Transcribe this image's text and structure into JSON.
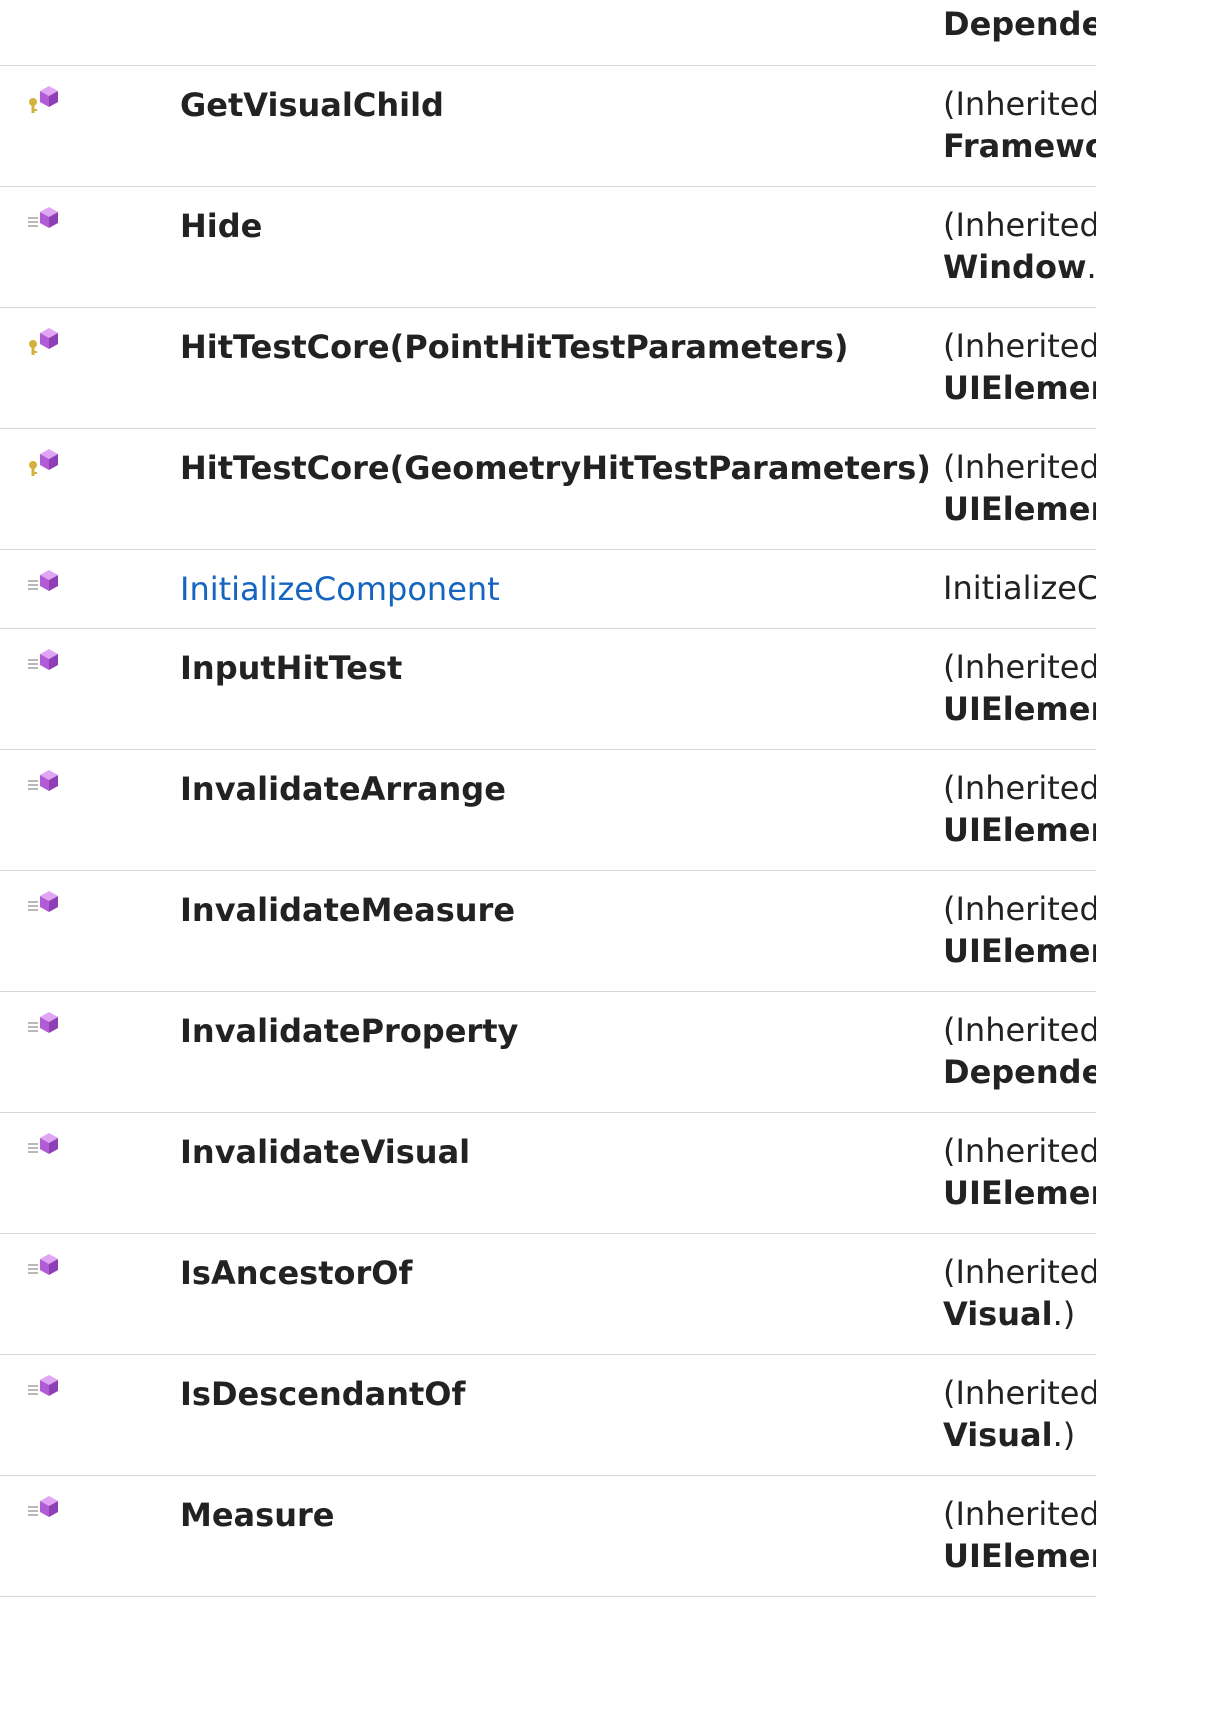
{
  "top_row": {
    "desc_line2_strong": "Dependency"
  },
  "rows": [
    {
      "icon": "protected-method-icon",
      "name": "GetVisualChild",
      "name_style": "bold",
      "desc_line1": "(Inherited from",
      "desc_line2_strong": "FrameworkElement",
      "desc_line2_tail": ""
    },
    {
      "icon": "public-method-icon",
      "name": "Hide",
      "name_style": "bold",
      "desc_line1": "(Inherited from",
      "desc_line2_strong": "Window",
      "desc_line2_tail": ".)"
    },
    {
      "icon": "protected-method-icon",
      "name": "HitTestCore(PointHitTestParameters)",
      "name_style": "bold",
      "desc_line1": "(Inherited from",
      "desc_line2_strong": "UIElement",
      "desc_line2_tail": ""
    },
    {
      "icon": "protected-method-icon",
      "name": "HitTestCore(GeometryHitTestParameters)",
      "name_style": "bold",
      "desc_line1": "(Inherited from",
      "desc_line2_strong": "UIElement",
      "desc_line2_tail": ""
    },
    {
      "icon": "public-method-icon",
      "name": "InitializeComponent",
      "name_style": "link",
      "desc_line1": "InitializeComponent",
      "desc_line2_strong": "",
      "desc_line2_tail": ""
    },
    {
      "icon": "public-method-icon",
      "name": "InputHitTest",
      "name_style": "bold",
      "desc_line1": "(Inherited from",
      "desc_line2_strong": "UIElement",
      "desc_line2_tail": ""
    },
    {
      "icon": "public-method-icon",
      "name": "InvalidateArrange",
      "name_style": "bold",
      "desc_line1": "(Inherited from",
      "desc_line2_strong": "UIElement",
      "desc_line2_tail": ""
    },
    {
      "icon": "public-method-icon",
      "name": "InvalidateMeasure",
      "name_style": "bold",
      "desc_line1": "(Inherited from",
      "desc_line2_strong": "UIElement",
      "desc_line2_tail": ""
    },
    {
      "icon": "public-method-icon",
      "name": "InvalidateProperty",
      "name_style": "bold",
      "desc_line1": "(Inherited from",
      "desc_line2_strong": "DependencyObject",
      "desc_line2_tail": ""
    },
    {
      "icon": "public-method-icon",
      "name": "InvalidateVisual",
      "name_style": "bold",
      "desc_line1": "(Inherited from",
      "desc_line2_strong": "UIElement",
      "desc_line2_tail": ""
    },
    {
      "icon": "public-method-icon",
      "name": "IsAncestorOf",
      "name_style": "bold",
      "desc_line1": "(Inherited from",
      "desc_line2_strong": "Visual",
      "desc_line2_tail": ".)"
    },
    {
      "icon": "public-method-icon",
      "name": "IsDescendantOf",
      "name_style": "bold",
      "desc_line1": "(Inherited from",
      "desc_line2_strong": "Visual",
      "desc_line2_tail": ".)"
    },
    {
      "icon": "public-method-icon",
      "name": "Measure",
      "name_style": "bold",
      "desc_line1": "(Inherited from",
      "desc_line2_strong": "UIElement",
      "desc_line2_tail": ""
    }
  ],
  "colors": {
    "link": "#1565c0",
    "text": "#222222",
    "divider": "#d9d9d9",
    "icon_cube": "#b15bd6",
    "icon_key": "#d4b13c"
  }
}
